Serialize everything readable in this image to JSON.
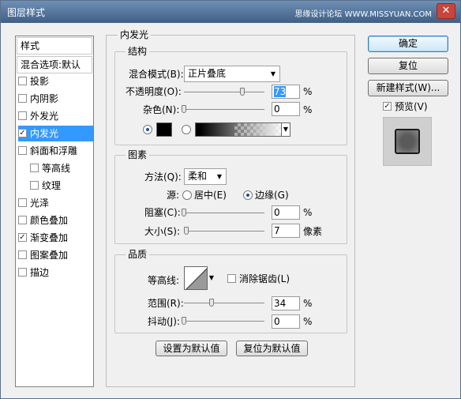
{
  "window": {
    "title": "图层样式",
    "watermark": "思缘设计论坛 WWW.MISSYUAN.COM",
    "close_glyph": "✕"
  },
  "left": {
    "header_styles": "样式",
    "header_blend": "混合选项:默认",
    "items": [
      {
        "label": "投影",
        "checked": false
      },
      {
        "label": "内阴影",
        "checked": false
      },
      {
        "label": "外发光",
        "checked": false
      },
      {
        "label": "内发光",
        "checked": true,
        "selected": true
      },
      {
        "label": "斜面和浮雕",
        "checked": false
      },
      {
        "label": "等高线",
        "checked": false
      },
      {
        "label": "纹理",
        "checked": false
      },
      {
        "label": "光泽",
        "checked": false
      },
      {
        "label": "颜色叠加",
        "checked": false
      },
      {
        "label": "渐变叠加",
        "checked": true
      },
      {
        "label": "图案叠加",
        "checked": false
      },
      {
        "label": "描边",
        "checked": false
      }
    ],
    "check_glyph": "✓"
  },
  "panel": {
    "title": "内发光",
    "structure": {
      "title": "结构",
      "blend_mode_label": "混合模式(B):",
      "blend_mode_value": "正片叠底",
      "opacity_label": "不透明度(O):",
      "opacity_value": "73",
      "opacity_level": 0.73,
      "noise_label": "杂色(N):",
      "noise_value": "0",
      "noise_level": 0,
      "unit_percent": "%",
      "color_hex": "#000000",
      "dropdown_arrow": "▼"
    },
    "elements": {
      "title": "图素",
      "method_label": "方法(Q):",
      "method_value": "柔和",
      "source_label": "源:",
      "source_center": "居中(E)",
      "source_edge": "边缘(G)",
      "source_selected": "edge",
      "choke_label": "阻塞(C):",
      "choke_value": "0",
      "choke_level": 0,
      "size_label": "大小(S):",
      "size_value": "7",
      "size_unit": "像素",
      "size_level": 0.028
    },
    "quality": {
      "title": "品质",
      "contour_label": "等高线:",
      "antialias_label": "消除锯齿(L)",
      "antialias_checked": false,
      "range_label": "范围(R):",
      "range_value": "34",
      "range_level": 0.34,
      "jitter_label": "抖动(J):",
      "jitter_value": "0",
      "jitter_level": 0
    },
    "set_default": "设置为默认值",
    "reset_default": "复位为默认值"
  },
  "right": {
    "ok": "确定",
    "reset": "复位",
    "new_style": "新建样式(W)...",
    "preview_label": "预览(V)",
    "preview_checked": true
  }
}
